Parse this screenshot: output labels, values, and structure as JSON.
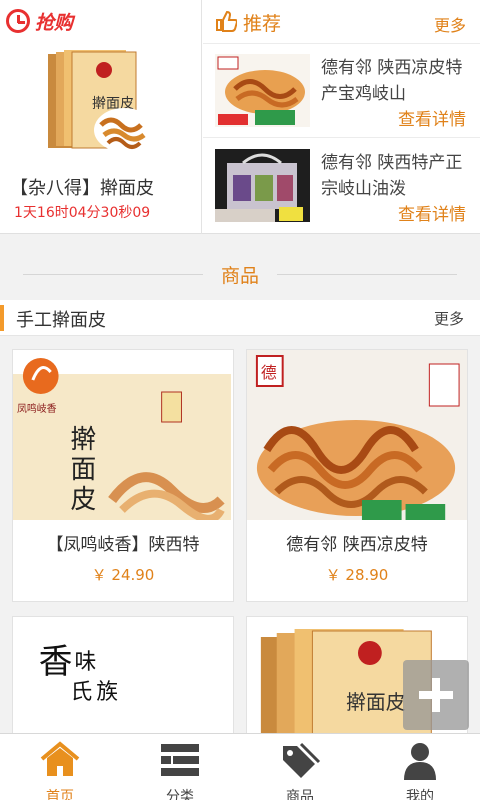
{
  "flash_sale": {
    "title": "抢购",
    "product_name": "【杂八得】擀面皮",
    "timer": "1天16时04分30秒09",
    "accent": "#e83030"
  },
  "recommend": {
    "title": "推荐",
    "more": "更多",
    "items": [
      {
        "desc": "德有邻 陕西凉皮特产宝鸡岐山",
        "detail": "查看详情"
      },
      {
        "desc": "德有邻 陕西特产正宗岐山油泼",
        "detail": "查看详情"
      }
    ]
  },
  "section": {
    "title": "商品"
  },
  "category": {
    "title": "手工擀面皮",
    "more": "更多"
  },
  "products": [
    {
      "name": "【凤鸣岐香】陕西特",
      "price": "￥ 24.90"
    },
    {
      "name": "德有邻 陕西凉皮特",
      "price": "￥ 28.90"
    },
    {
      "name": "",
      "price": ""
    },
    {
      "name": "",
      "price": ""
    }
  ],
  "nav": {
    "tabs": [
      {
        "label": "首页",
        "icon": "home-icon",
        "active": true
      },
      {
        "label": "分类",
        "icon": "list-icon",
        "active": false
      },
      {
        "label": "商品",
        "icon": "tag-icon",
        "active": false
      },
      {
        "label": "我的",
        "icon": "user-icon",
        "active": false
      }
    ]
  },
  "colors": {
    "accent": "#e0821a",
    "flash": "#e83030",
    "bar": "#f39a2b"
  }
}
